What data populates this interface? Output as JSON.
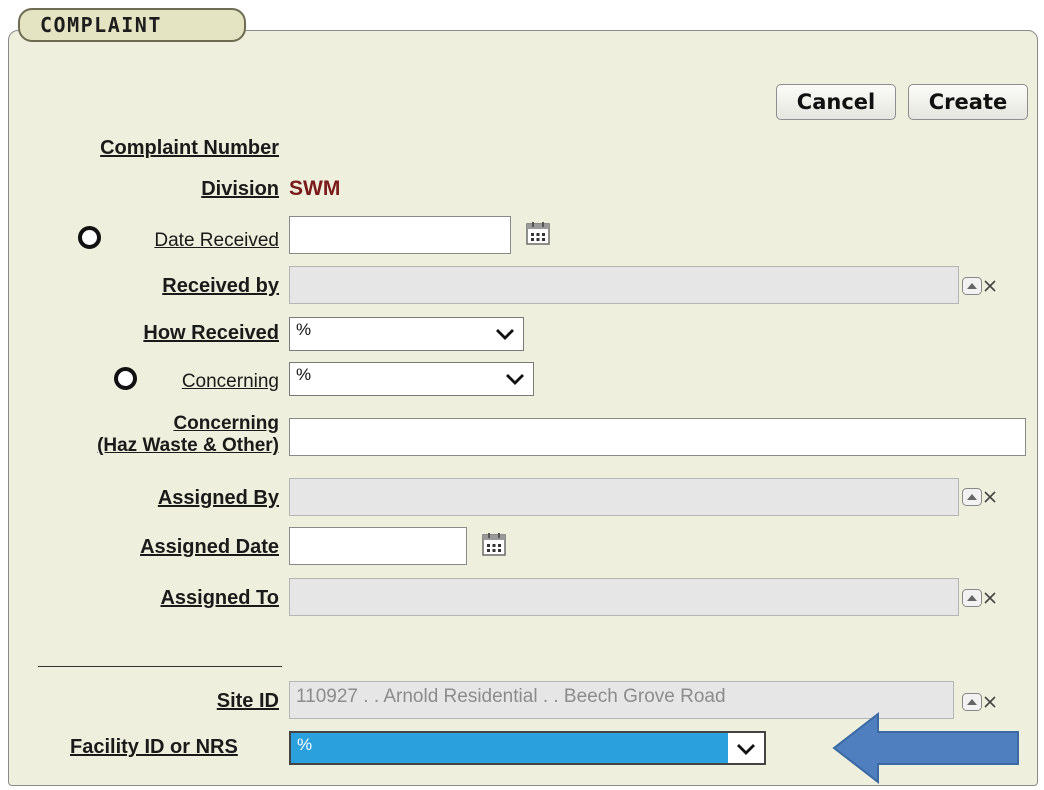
{
  "legend": "COMPLAINT",
  "buttons": {
    "cancel": "Cancel",
    "create": "Create"
  },
  "labels": {
    "complaint_number": "Complaint Number",
    "division": "Division",
    "date_received": "Date Received",
    "received_by": "Received by",
    "how_received": "How Received",
    "concerning": "Concerning",
    "concerning_haz_1": "Concerning",
    "concerning_haz_2": "(Haz Waste & Other)",
    "assigned_by": "Assigned By",
    "assigned_date": "Assigned Date",
    "assigned_to": "Assigned To",
    "site_id": "Site ID",
    "facility_id": "Facility ID or NRS"
  },
  "values": {
    "division": "SWM",
    "how_received": "%",
    "concerning": "%",
    "site_id": "110927 . . Arnold Residential . . Beech Grove Road",
    "facility_id": "%"
  },
  "colors": {
    "panel_bg": "#efefdd",
    "division_text": "#7a1a1a",
    "selected_highlight": "#2aa0dd",
    "arrow": "#4f7fbf"
  },
  "icons": {
    "calendar": "calendar-icon",
    "lookup": "lookup-icon",
    "clear": "clear-x-icon",
    "dropdown": "chevron-down-icon",
    "required": "required-radio-icon",
    "pointer": "arrow-left-icon"
  }
}
